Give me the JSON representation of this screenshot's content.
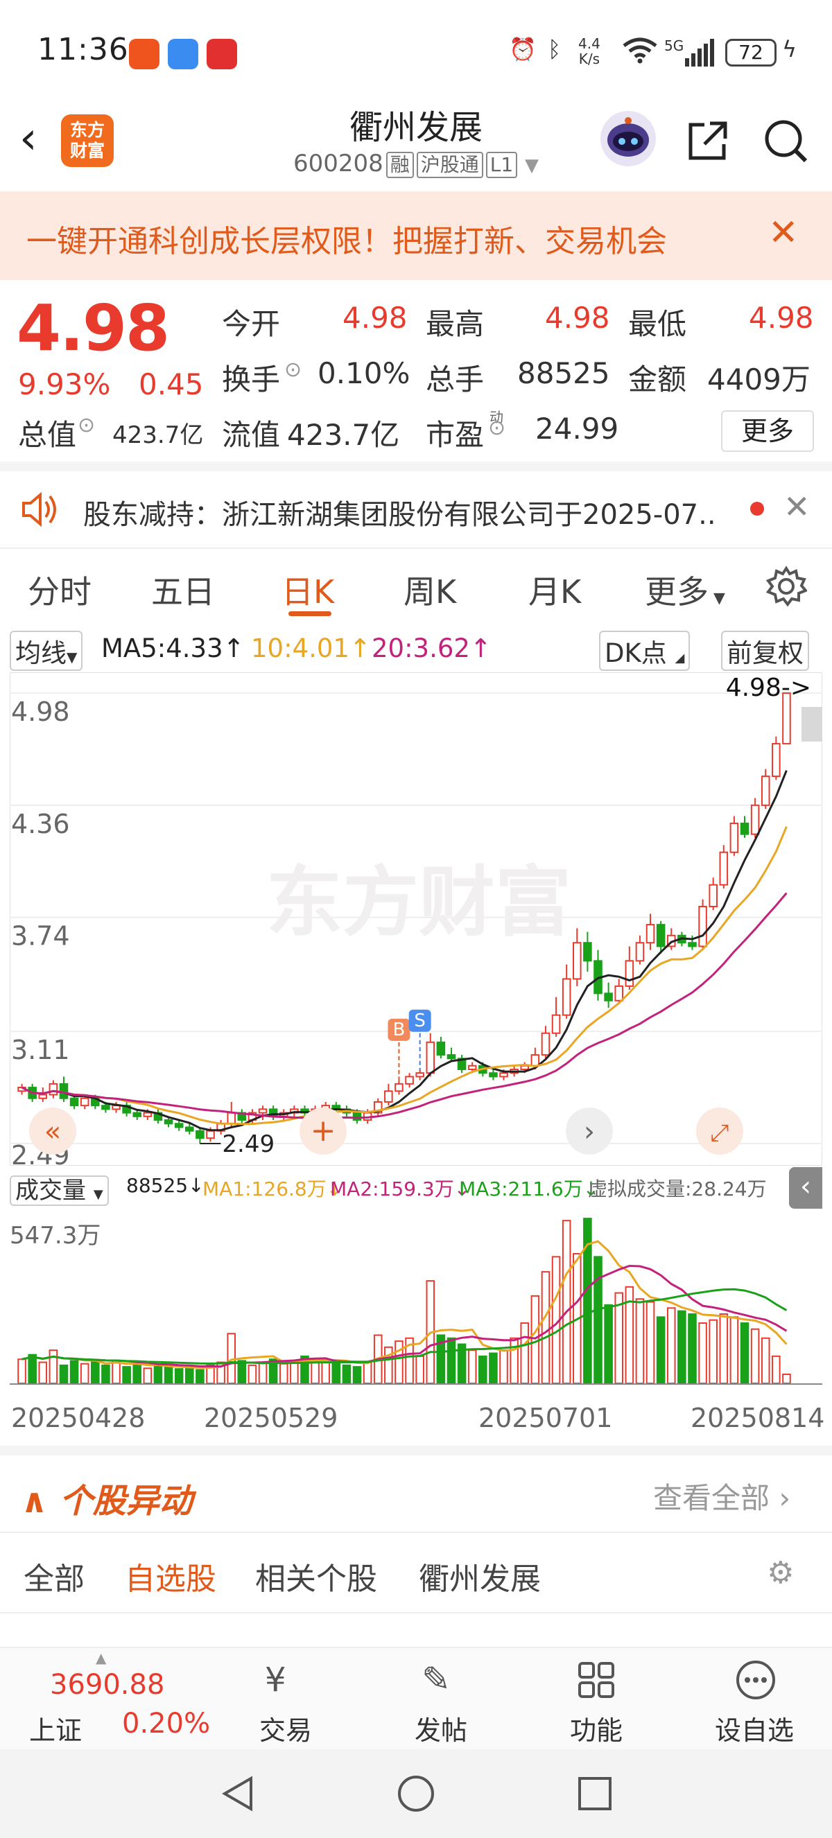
{
  "status_bar": {
    "time": "11:36",
    "net_speed_top": "4.4",
    "net_speed_bottom": "K/s",
    "network": "5G",
    "battery": "72"
  },
  "header": {
    "logo_line1": "东方",
    "logo_line2": "财富",
    "stock_name": "衢州发展",
    "stock_code": "600208",
    "tags": [
      "融",
      "沪股通",
      "L1"
    ]
  },
  "banner": {
    "text": "一键开通科创成长层权限！把握打新、交易机会"
  },
  "quote": {
    "price": "4.98",
    "change_pct": "9.93%",
    "change": "0.45",
    "market_cap_label": "总值",
    "market_cap": "423.7亿",
    "fields": {
      "open_label": "今开",
      "open": "4.98",
      "high_label": "最高",
      "high": "4.98",
      "low_label": "最低",
      "low": "4.98",
      "turnover_label": "换手",
      "turnover": "0.10%",
      "volume_label": "总手",
      "volume": "88525",
      "amount_label": "金额",
      "amount": "4409万",
      "float_label": "流值",
      "float_cap": "423.7亿",
      "pe_label": "市盈",
      "pe_sup": "动",
      "pe": "24.99"
    },
    "more_button": "更多"
  },
  "notice": {
    "text": "股东减持：浙江新湖集团股份有限公司于2025-07..",
    "accent_color": "#e83b2e"
  },
  "tabs": {
    "items": [
      "分时",
      "五日",
      "日K",
      "周K",
      "月K",
      "更多"
    ],
    "active": "日K"
  },
  "ma_bar": {
    "selector": "均线",
    "ma5": "MA5:4.33↑",
    "ma10": "10:4.01↑",
    "ma20": "20:3.62↑",
    "dk_button": "DK点",
    "adjust_button": "前复权"
  },
  "chart_data": [
    {
      "type": "candlestick",
      "axis_labels": [
        "4.98",
        "4.36",
        "3.74",
        "3.11",
        "2.49"
      ],
      "ylim": [
        2.49,
        4.98
      ],
      "last_price_marker": "4.98->",
      "low_marker": "2.49",
      "markers": [
        "B",
        "S"
      ],
      "series_colors": {
        "up": "#e83b2e",
        "down": "#1aa11a",
        "ma5": "#222222",
        "ma10": "#e8a623",
        "ma20": "#c2217c"
      },
      "watermark": "东方财富",
      "candles": [
        [
          2.78,
          2.8,
          2.76,
          2.82
        ],
        [
          2.8,
          2.74,
          2.72,
          2.82
        ],
        [
          2.74,
          2.76,
          2.72,
          2.8
        ],
        [
          2.76,
          2.82,
          2.74,
          2.84
        ],
        [
          2.82,
          2.74,
          2.72,
          2.86
        ],
        [
          2.74,
          2.7,
          2.68,
          2.76
        ],
        [
          2.7,
          2.74,
          2.68,
          2.76
        ],
        [
          2.74,
          2.7,
          2.68,
          2.76
        ],
        [
          2.7,
          2.68,
          2.66,
          2.72
        ],
        [
          2.68,
          2.7,
          2.66,
          2.72
        ],
        [
          2.7,
          2.66,
          2.64,
          2.72
        ],
        [
          2.66,
          2.64,
          2.62,
          2.68
        ],
        [
          2.64,
          2.66,
          2.62,
          2.68
        ],
        [
          2.66,
          2.62,
          2.6,
          2.68
        ],
        [
          2.62,
          2.6,
          2.58,
          2.64
        ],
        [
          2.6,
          2.58,
          2.56,
          2.62
        ],
        [
          2.58,
          2.56,
          2.54,
          2.6
        ],
        [
          2.56,
          2.52,
          2.49,
          2.58
        ],
        [
          2.52,
          2.56,
          2.5,
          2.58
        ],
        [
          2.56,
          2.6,
          2.54,
          2.62
        ],
        [
          2.6,
          2.66,
          2.58,
          2.72
        ],
        [
          2.66,
          2.62,
          2.6,
          2.68
        ],
        [
          2.62,
          2.66,
          2.6,
          2.68
        ],
        [
          2.66,
          2.68,
          2.62,
          2.7
        ],
        [
          2.68,
          2.64,
          2.62,
          2.7
        ],
        [
          2.64,
          2.66,
          2.62,
          2.68
        ],
        [
          2.66,
          2.68,
          2.64,
          2.7
        ],
        [
          2.68,
          2.66,
          2.64,
          2.7
        ],
        [
          2.66,
          2.68,
          2.64,
          2.7
        ],
        [
          2.68,
          2.7,
          2.66,
          2.72
        ],
        [
          2.7,
          2.68,
          2.66,
          2.72
        ],
        [
          2.68,
          2.66,
          2.64,
          2.7
        ],
        [
          2.66,
          2.62,
          2.6,
          2.68
        ],
        [
          2.62,
          2.66,
          2.6,
          2.68
        ],
        [
          2.66,
          2.72,
          2.64,
          2.74
        ],
        [
          2.72,
          2.78,
          2.7,
          2.82
        ],
        [
          2.78,
          2.82,
          2.76,
          2.86
        ],
        [
          2.82,
          2.86,
          2.8,
          2.88
        ],
        [
          2.86,
          2.88,
          2.84,
          2.9
        ],
        [
          2.88,
          3.05,
          2.86,
          3.1
        ],
        [
          3.05,
          2.98,
          2.96,
          3.08
        ],
        [
          2.98,
          2.96,
          2.94,
          3.02
        ],
        [
          2.96,
          2.9,
          2.88,
          2.98
        ],
        [
          2.9,
          2.92,
          2.88,
          2.94
        ],
        [
          2.92,
          2.88,
          2.86,
          2.94
        ],
        [
          2.88,
          2.86,
          2.84,
          2.9
        ],
        [
          2.86,
          2.88,
          2.84,
          2.9
        ],
        [
          2.88,
          2.9,
          2.86,
          2.92
        ],
        [
          2.9,
          2.92,
          2.88,
          2.94
        ],
        [
          2.92,
          2.98,
          2.9,
          3.02
        ],
        [
          2.98,
          3.1,
          2.96,
          3.14
        ],
        [
          3.1,
          3.2,
          3.08,
          3.3
        ],
        [
          3.2,
          3.4,
          3.18,
          3.48
        ],
        [
          3.4,
          3.6,
          3.36,
          3.68
        ],
        [
          3.6,
          3.5,
          3.44,
          3.66
        ],
        [
          3.5,
          3.32,
          3.28,
          3.56
        ],
        [
          3.32,
          3.28,
          3.24,
          3.38
        ],
        [
          3.28,
          3.36,
          3.26,
          3.4
        ],
        [
          3.36,
          3.5,
          3.34,
          3.58
        ],
        [
          3.5,
          3.6,
          3.48,
          3.64
        ],
        [
          3.6,
          3.7,
          3.56,
          3.76
        ],
        [
          3.7,
          3.58,
          3.54,
          3.72
        ],
        [
          3.58,
          3.64,
          3.56,
          3.68
        ],
        [
          3.64,
          3.6,
          3.58,
          3.66
        ],
        [
          3.6,
          3.58,
          3.56,
          3.64
        ],
        [
          3.58,
          3.8,
          3.56,
          3.84
        ],
        [
          3.8,
          3.92,
          3.78,
          3.96
        ],
        [
          3.92,
          4.1,
          3.9,
          4.14
        ],
        [
          4.1,
          4.26,
          4.08,
          4.3
        ],
        [
          4.26,
          4.2,
          4.18,
          4.3
        ],
        [
          4.2,
          4.36,
          4.18,
          4.4
        ],
        [
          4.36,
          4.52,
          4.34,
          4.56
        ],
        [
          4.52,
          4.7,
          4.5,
          4.74
        ],
        [
          4.7,
          4.98,
          4.7,
          4.98
        ]
      ]
    },
    {
      "type": "bar",
      "selector": "成交量",
      "volume_label": "88525↓",
      "ma1": "MA1:126.8万↓",
      "ma2": "MA2:159.3万↓",
      "ma3": "MA3:211.6万↓",
      "virtual_volume": "虚拟成交量:28.24万",
      "max_label": "547.3万",
      "x_labels": [
        "20250428",
        "20250529",
        "20250701",
        "20250814"
      ],
      "values": [
        80,
        95,
        70,
        110,
        60,
        75,
        65,
        70,
        60,
        75,
        55,
        65,
        50,
        60,
        55,
        48,
        52,
        45,
        60,
        70,
        165,
        75,
        60,
        70,
        80,
        65,
        70,
        90,
        75,
        80,
        70,
        60,
        55,
        70,
        160,
        120,
        140,
        150,
        90,
        340,
        160,
        150,
        130,
        110,
        90,
        100,
        110,
        150,
        200,
        290,
        370,
        420,
        540,
        430,
        547,
        420,
        260,
        300,
        320,
        280,
        270,
        220,
        250,
        240,
        230,
        200,
        210,
        230,
        220,
        200,
        180,
        150,
        90,
        30
      ],
      "ylim": [
        0,
        547.3
      ],
      "unit": "万"
    }
  ],
  "anomaly": {
    "title": "个股异动",
    "view_all": "查看全部",
    "tabs": [
      "全部",
      "自选股",
      "相关个股",
      "衢州发展"
    ],
    "active_tab": "自选股"
  },
  "bottom_bar": {
    "index_value": "3690.88",
    "index_name": "上证",
    "index_pct": "0.20%",
    "items": [
      "交易",
      "发帖",
      "功能",
      "设自选"
    ]
  }
}
